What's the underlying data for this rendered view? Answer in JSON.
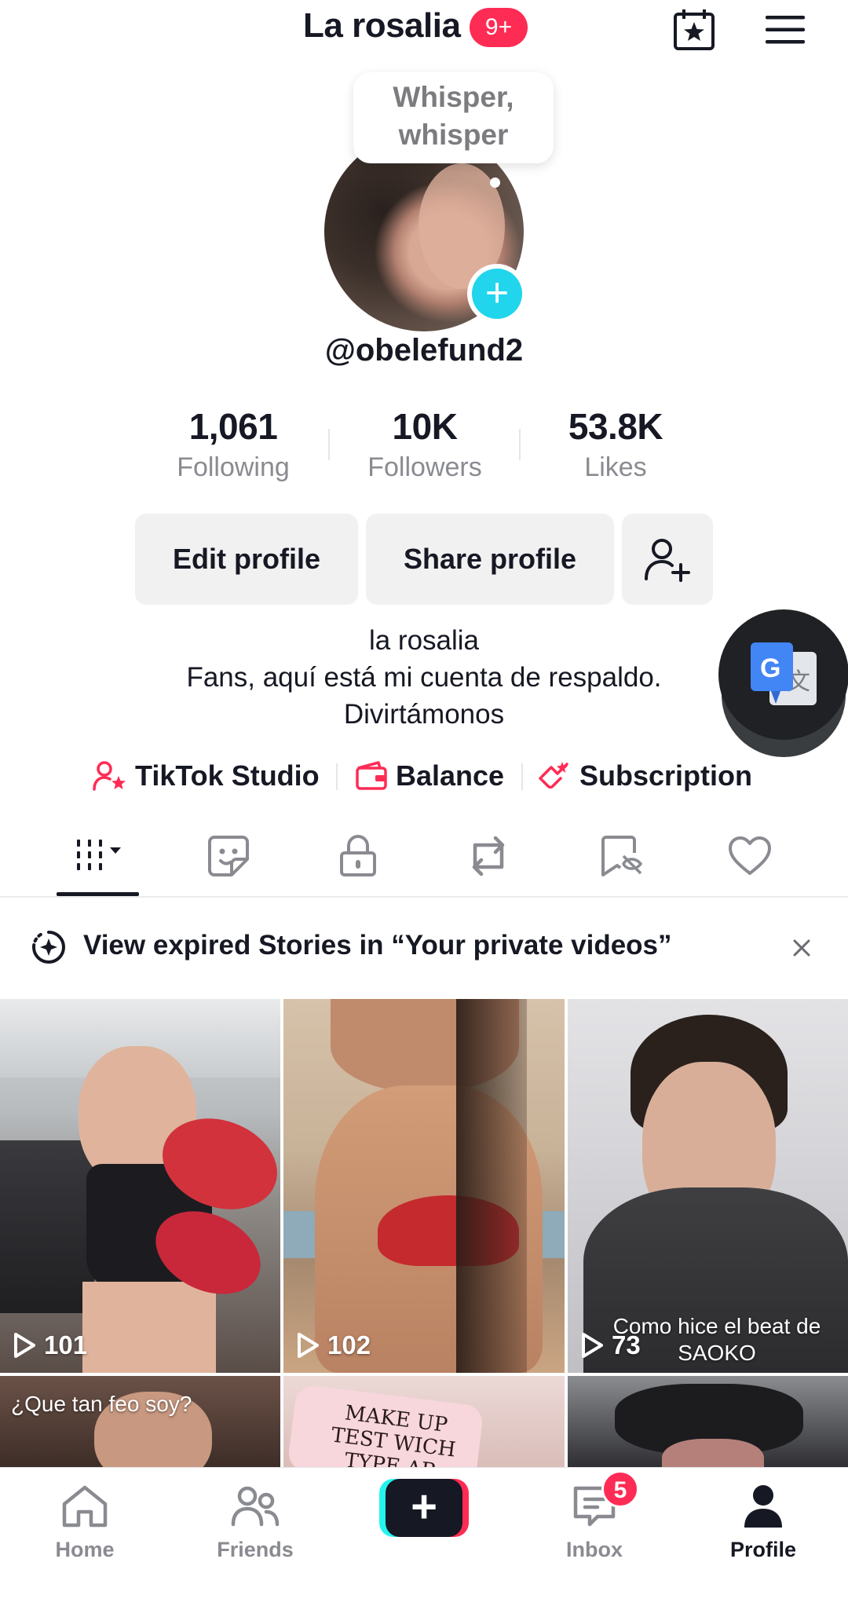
{
  "header": {
    "title": "La rosalia",
    "notifications": "9+"
  },
  "profile": {
    "note": [
      "Whisper,",
      "whisper"
    ],
    "handle": "@obelefund2",
    "stats": [
      {
        "value": "1,061",
        "label": "Following"
      },
      {
        "value": "10K",
        "label": "Followers"
      },
      {
        "value": "53.8K",
        "label": "Likes"
      }
    ],
    "buttons": {
      "edit": "Edit profile",
      "share": "Share profile"
    },
    "bio": [
      "la rosalia",
      "Fans, aquí está mi cuenta de respaldo.",
      "Divirtámonos"
    ],
    "links": [
      {
        "label": "TikTok Studio",
        "icon": "studio-icon"
      },
      {
        "label": "Balance",
        "icon": "wallet-icon"
      },
      {
        "label": "Subscription",
        "icon": "subscription-icon"
      }
    ]
  },
  "tabs": [
    "videos-grid-icon",
    "stickers-icon",
    "lock-icon",
    "repost-icon",
    "favorites-icon",
    "liked-icon"
  ],
  "banner": {
    "text": "View expired Stories in “Your private videos”"
  },
  "videos": [
    {
      "views": "101",
      "caption": ""
    },
    {
      "views": "102",
      "caption": ""
    },
    {
      "views": "73",
      "caption": "Como hice el beat de SAOKO"
    },
    {
      "views": "",
      "caption": "¿Que tan feo soy?"
    },
    {
      "views": "",
      "caption": "MAKE UP TEST WICH TYPE AR"
    },
    {
      "views": "",
      "caption": ""
    }
  ],
  "nav": {
    "home": "Home",
    "friends": "Friends",
    "inbox": "Inbox",
    "inbox_badge": "5",
    "profile": "Profile"
  },
  "colors": {
    "accent": "#fe2c55",
    "cyan": "#20d5ec",
    "text": "#161823",
    "muted": "#8a8b91"
  }
}
